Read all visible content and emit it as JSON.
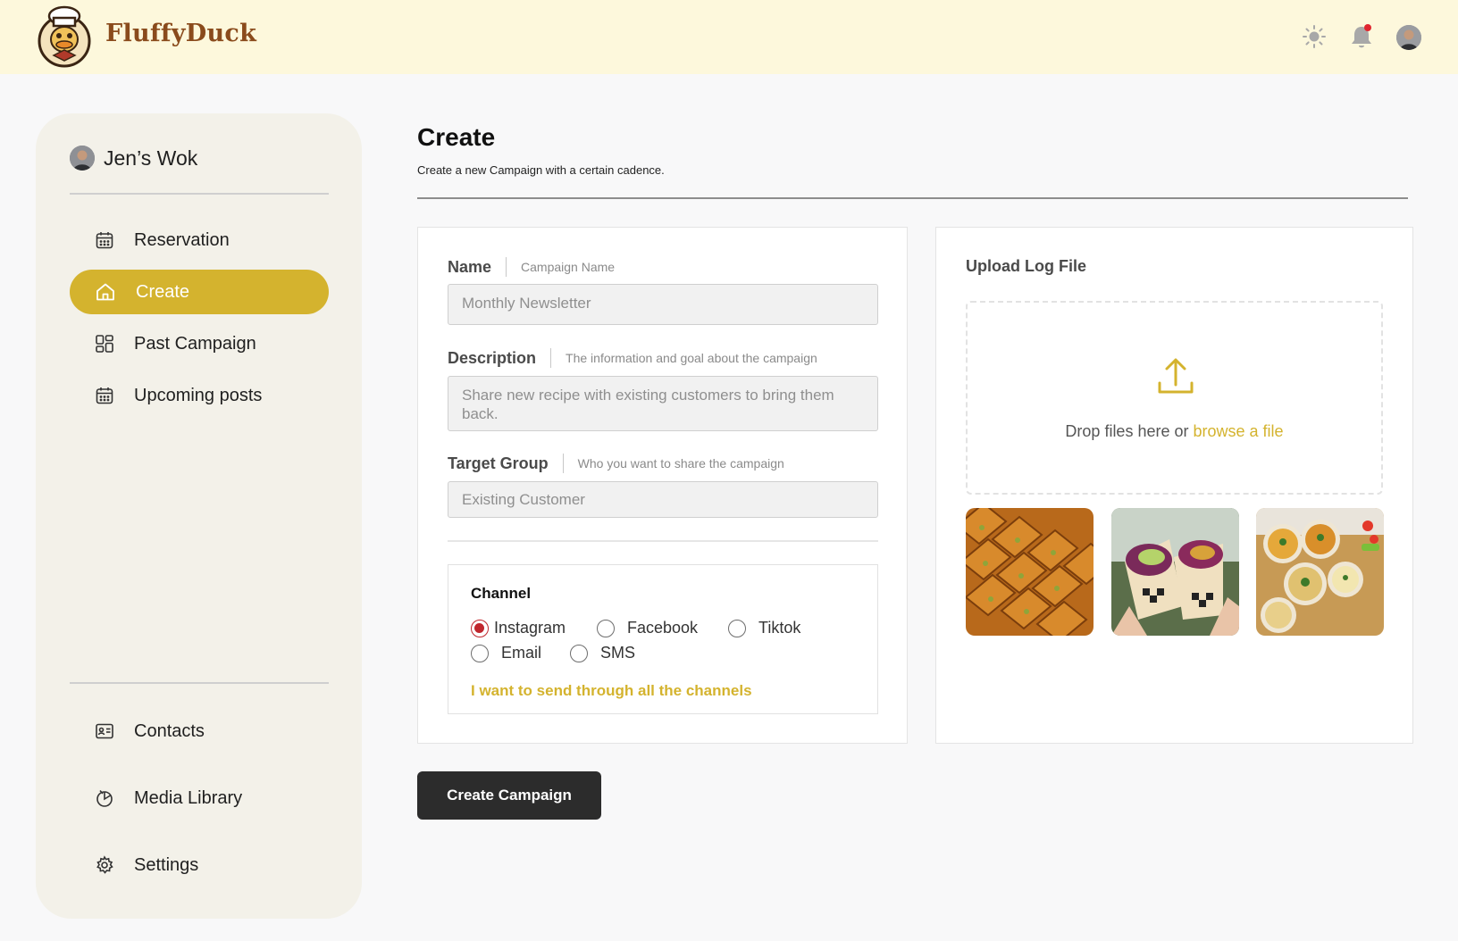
{
  "header": {
    "brand": "FluffyDuck",
    "icons": [
      "logo-duck-chef",
      "sun-icon",
      "bell-icon",
      "user-avatar"
    ]
  },
  "sidebar": {
    "profile_name": "Jen’s Wok",
    "items": [
      {
        "label": "Reservation",
        "icon": "calendar-icon"
      },
      {
        "label": "Create",
        "icon": "home-icon",
        "active": true
      },
      {
        "label": "Past Campaign",
        "icon": "grid-icon"
      },
      {
        "label": "Upcoming posts",
        "icon": "calendar-icon"
      }
    ],
    "bottom_items": [
      {
        "label": "Contacts",
        "icon": "contact-card-icon"
      },
      {
        "label": "Media Library",
        "icon": "media-icon"
      },
      {
        "label": "Settings",
        "icon": "gear-icon"
      }
    ]
  },
  "page": {
    "title": "Create",
    "subtitle": "Create a new Campaign with a certain cadence."
  },
  "form": {
    "name": {
      "label": "Name",
      "hint": "Campaign Name",
      "value": "Monthly Newsletter"
    },
    "description": {
      "label": "Description",
      "hint": "The information and goal about the campaign",
      "value": "Share new recipe with existing customers to bring them back."
    },
    "target": {
      "label": "Target Group",
      "hint": "Who you want to share the campaign",
      "value": "Existing Customer"
    },
    "channel": {
      "title": "Channel",
      "options": [
        "Instagram",
        "Facebook",
        "Tiktok",
        "Email",
        "SMS"
      ],
      "selected": "Instagram",
      "all_link": "I want to send through all the channels"
    }
  },
  "upload": {
    "title": "Upload Log File",
    "drop_text": "Drop files here or",
    "browse_link": "browse a file",
    "thumbnails": [
      "baklava-photo",
      "wrap-sandwich-photo",
      "curry-bowls-photo"
    ]
  },
  "actions": {
    "create_label": "Create Campaign"
  },
  "colors": {
    "accent": "#d4b32e",
    "topbar": "#fdf8dc",
    "sidebar": "#f3f1e9",
    "radio_checked": "#c0262d",
    "button": "#2c2c2c"
  }
}
